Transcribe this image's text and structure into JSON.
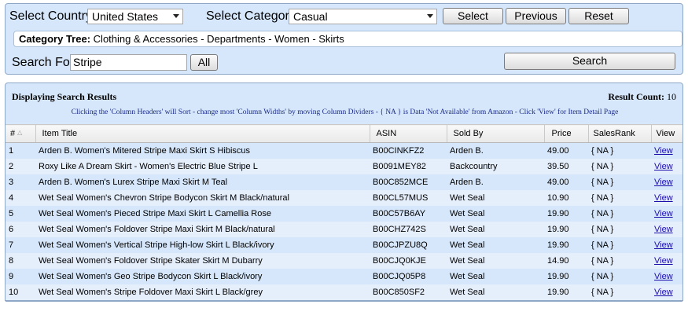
{
  "search_panel": {
    "country_label": "Select Country:",
    "country_value": "United States",
    "category_label": "Select Category:",
    "category_value": "Casual",
    "select_button": "Select",
    "previous_button": "Previous",
    "reset_button": "Reset",
    "tree_label": "Category Tree:",
    "tree_value": "Clothing & Accessories - Departments - Women - Skirts",
    "search_label": "Search For:",
    "search_value": "Stripe",
    "all_button": "All",
    "search_button": "Search"
  },
  "results": {
    "title": "Displaying Search Results",
    "count_label": "Result Count:",
    "count_value": "10",
    "instructions": "Clicking the 'Column Headers' will Sort - change most 'Column Widths' by moving Column Dividers - { NA } is Data 'Not Available' from Amazon - Click 'View' for Item Detail Page",
    "columns": [
      "#",
      "Item Title",
      "ASIN",
      "Sold By",
      "Price",
      "SalesRank",
      "View"
    ],
    "rows": [
      {
        "num": "1",
        "title": "Arden B. Women's Mitered Stripe Maxi Skirt S Hibiscus",
        "asin": "B00CINKFZ2",
        "sold_by": "Arden B.",
        "price": "49.00",
        "rank": "{ NA }",
        "view": "View"
      },
      {
        "num": "2",
        "title": "Roxy Like A Dream Skirt - Women's Electric Blue Stripe L",
        "asin": "B0091MEY82",
        "sold_by": "Backcountry",
        "price": "39.50",
        "rank": "{ NA }",
        "view": "View"
      },
      {
        "num": "3",
        "title": "Arden B. Women's Lurex Stripe Maxi Skirt M Teal",
        "asin": "B00C852MCE",
        "sold_by": "Arden B.",
        "price": "49.00",
        "rank": "{ NA }",
        "view": "View"
      },
      {
        "num": "4",
        "title": "Wet Seal Women's Chevron Stripe Bodycon Skirt M Black/natural",
        "asin": "B00CL57MUS",
        "sold_by": "Wet Seal",
        "price": "10.90",
        "rank": "{ NA }",
        "view": "View"
      },
      {
        "num": "5",
        "title": "Wet Seal Women's Pieced Stripe Maxi Skirt L Camellia Rose",
        "asin": "B00C57B6AY",
        "sold_by": "Wet Seal",
        "price": "19.90",
        "rank": "{ NA }",
        "view": "View"
      },
      {
        "num": "6",
        "title": "Wet Seal Women's Foldover Stripe Maxi Skirt M Black/natural",
        "asin": "B00CHZ742S",
        "sold_by": "Wet Seal",
        "price": "19.90",
        "rank": "{ NA }",
        "view": "View"
      },
      {
        "num": "7",
        "title": "Wet Seal Women's Vertical Stripe High-low Skirt L Black/ivory",
        "asin": "B00CJPZU8Q",
        "sold_by": "Wet Seal",
        "price": "19.90",
        "rank": "{ NA }",
        "view": "View"
      },
      {
        "num": "8",
        "title": "Wet Seal Women's Foldover Stripe Skater Skirt M Dubarry",
        "asin": "B00CJQ0KJE",
        "sold_by": "Wet Seal",
        "price": "14.90",
        "rank": "{ NA }",
        "view": "View"
      },
      {
        "num": "9",
        "title": "Wet Seal Women's Geo Stripe Bodycon Skirt L Black/ivory",
        "asin": "B00CJQ05P8",
        "sold_by": "Wet Seal",
        "price": "19.90",
        "rank": "{ NA }",
        "view": "View"
      },
      {
        "num": "10",
        "title": "Wet Seal Women's Stripe Foldover Maxi Skirt L Black/grey",
        "asin": "B00C850SF2",
        "sold_by": "Wet Seal",
        "price": "19.90",
        "rank": "{ NA }",
        "view": "View"
      }
    ]
  },
  "colors": {
    "panel_bg": "#d6e7fb",
    "alt_row": "#e5eefb",
    "link": "#1a0dab"
  }
}
